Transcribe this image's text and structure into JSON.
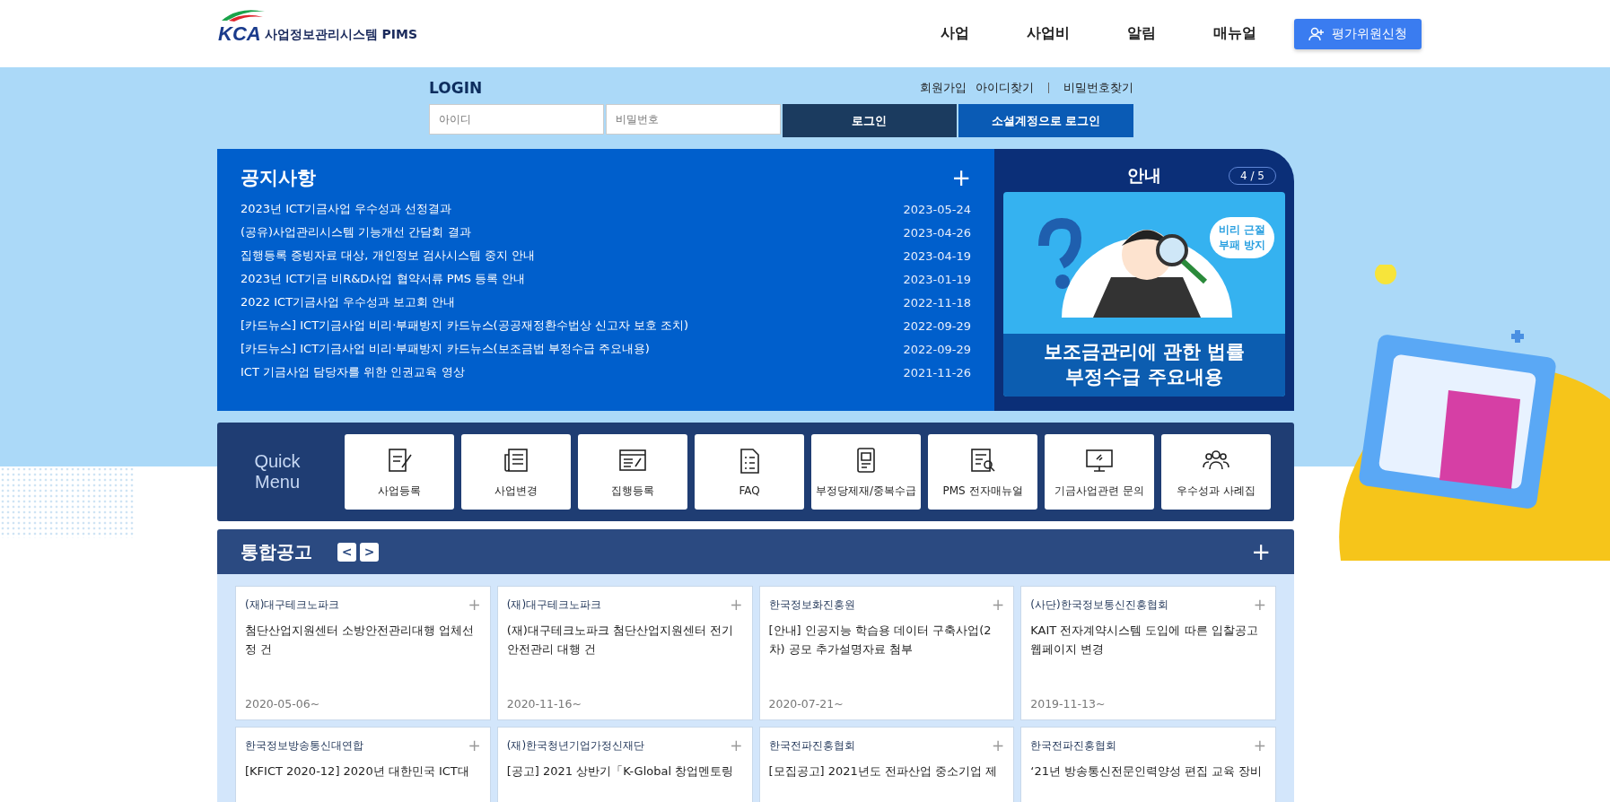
{
  "header": {
    "logo_mark": "KCA",
    "logo_text": "사업정보관리시스템 PIMS",
    "nav": [
      "사업",
      "사업비",
      "알림",
      "매뉴얼"
    ],
    "apply_button": "평가위원신청"
  },
  "login": {
    "title": "LOGIN",
    "links": [
      "회원가입",
      "아이디찾기",
      "비밀번호찾기"
    ],
    "id_field": {
      "placeholder": "아이디"
    },
    "password_field": {
      "placeholder": "비밀번호"
    },
    "login_button": "로그인",
    "social_button": "소셜계정으로 로그인"
  },
  "notices": {
    "title": "공지사항",
    "more": "+",
    "items": [
      {
        "title": "2023년 ICT기금사업 우수성과 선정결과",
        "date": "2023-05-24"
      },
      {
        "title": "(공유)사업관리시스템 기능개선 간담회 결과",
        "date": "2023-04-26"
      },
      {
        "title": "집행등록 증빙자료 대상, 개인정보 검사시스템 중지 안내",
        "date": "2023-04-19"
      },
      {
        "title": "2023년 ICT기금 비R&D사업 협약서류 PMS 등록 안내",
        "date": "2023-01-19"
      },
      {
        "title": "2022 ICT기금사업 우수성과 보고회 안내",
        "date": "2022-11-18"
      },
      {
        "title": "[카드뉴스] ICT기금사업 비리·부패방지 카드뉴스(공공재정환수법상 신고자 보호 조치)",
        "date": "2022-09-29"
      },
      {
        "title": "[카드뉴스] ICT기금사업 비리·부패방지 카드뉴스(보조금법 부정수급 주요내용)",
        "date": "2022-09-29"
      },
      {
        "title": "ICT 기금사업 담당자를 위한 인권교육 영상",
        "date": "2021-11-26"
      }
    ]
  },
  "info": {
    "title": "안내",
    "pager": "4 / 5",
    "banner": {
      "bubble": [
        "비리 근절",
        "부패 방지"
      ],
      "headline": [
        "보조금관리에 관한 법률",
        "부정수급 주요내용"
      ]
    }
  },
  "quick_menu": {
    "title": [
      "Quick",
      "Menu"
    ],
    "items": [
      "사업등록",
      "사업변경",
      "집행등록",
      "FAQ",
      "부정당제재/중복수급",
      "PMS 전자매뉴얼",
      "기금사업관련 문의",
      "우수성과 사례집"
    ]
  },
  "announcements": {
    "title": "통합공고",
    "prev": "<",
    "next": ">",
    "more": "+",
    "cards": [
      {
        "org": "(재)대구테크노파크",
        "more": "+",
        "title": "첨단산업지원센터 소방안전관리대행 업체선정 건",
        "date": "2020-05-06~"
      },
      {
        "org": "(재)대구테크노파크",
        "more": "+",
        "title": "(재)대구테크노파크 첨단산업지원센터 전기안전관리 대행 건",
        "date": "2020-11-16~"
      },
      {
        "org": "한국정보화진흥원",
        "more": "+",
        "title": "[안내] 인공지능 학습용 데이터 구축사업(2차) 공모 추가설명자료 첨부",
        "date": "2020-07-21~"
      },
      {
        "org": "(사단)한국정보통신진흥협회",
        "more": "+",
        "title": "KAIT 전자계약시스템 도입에 따른 입찰공고 웹페이지 변경",
        "date": "2019-11-13~"
      },
      {
        "org": "한국정보방송통신대연합",
        "more": "+",
        "title": "[KFICT 2020-12] 2020년 대한민국 ICT대"
      },
      {
        "org": "(재)한국청년기업가정신재단",
        "more": "+",
        "title": "[공고] 2021 상반기「K-Global 창업멘토링"
      },
      {
        "org": "한국전파진흥협회",
        "more": "+",
        "title": "[모집공고] 2021년도 전파산업 중소기업 제"
      },
      {
        "org": "한국전파진흥협회",
        "more": "+",
        "title": "‘21년 방송통신전문인력양성 편집 교육 장비"
      }
    ]
  }
}
